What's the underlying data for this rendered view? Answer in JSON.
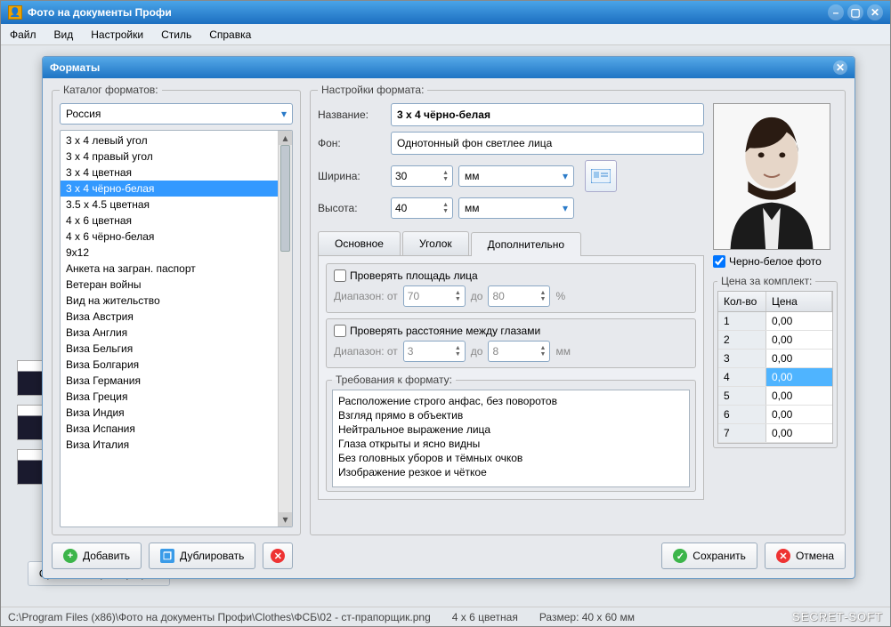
{
  "app": {
    "title": "Фото на документы Профи",
    "menus": [
      "Файл",
      "Вид",
      "Настройки",
      "Стиль",
      "Справка"
    ]
  },
  "dialog": {
    "title": "Форматы",
    "catalog": {
      "legend": "Каталог форматов:",
      "country": "Россия",
      "items": [
        "3 x 4 левый угол",
        "3 x 4 правый угол",
        "3 x 4 цветная",
        "3 x 4 чёрно-белая",
        "3.5 x 4.5 цветная",
        "4 x 6 цветная",
        "4 x 6 чёрно-белая",
        "9x12",
        "Анкета на загран. паспорт",
        "Ветеран войны",
        "Вид на жительство",
        "Виза Австрия",
        "Виза Англия",
        "Виза Бельгия",
        "Виза Болгария",
        "Виза Германия",
        "Виза Греция",
        "Виза Индия",
        "Виза Испания",
        "Виза Италия"
      ],
      "selected_index": 3
    },
    "settings": {
      "legend": "Настройки формата:",
      "name_label": "Название:",
      "name_value": "3 x 4 чёрно-белая",
      "bg_label": "Фон:",
      "bg_value": "Однотонный фон светлее лица",
      "width_label": "Ширина:",
      "width_value": "30",
      "height_label": "Высота:",
      "height_value": "40",
      "unit": "мм",
      "bw_label": "Черно-белое фото",
      "bw_checked": true,
      "tabs": {
        "main": "Основное",
        "corner": "Уголок",
        "extra": "Дополнительно",
        "active": "extra"
      },
      "face_area": {
        "legend": "Проверять площадь лица",
        "checked": false,
        "range_label": "Диапазон: от",
        "from": "70",
        "to_label": "до",
        "to": "80",
        "unit": "%"
      },
      "eye_dist": {
        "legend": "Проверять расстояние между глазами",
        "checked": false,
        "range_label": "Диапазон: от",
        "from": "3",
        "to_label": "до",
        "to": "8",
        "unit": "мм"
      },
      "requirements": {
        "legend": "Требования к формату:",
        "items": [
          "Расположение строго анфас, без поворотов",
          "Взгляд прямо в объектив",
          "Нейтральное выражение лица",
          "Глаза открыты и ясно видны",
          "Без головных уборов и тёмных очков",
          "Изображение резкое и чёткое"
        ]
      },
      "price": {
        "legend": "Цена за комплект:",
        "col_qty": "Кол-во",
        "col_price": "Цена",
        "rows": [
          {
            "qty": "1",
            "price": "0,00"
          },
          {
            "qty": "2",
            "price": "0,00"
          },
          {
            "qty": "3",
            "price": "0,00"
          },
          {
            "qty": "4",
            "price": "0,00"
          },
          {
            "qty": "5",
            "price": "0,00"
          },
          {
            "qty": "6",
            "price": "0,00"
          },
          {
            "qty": "7",
            "price": "0,00"
          }
        ],
        "selected_index": 3
      }
    },
    "buttons": {
      "add": "Добавить",
      "dup": "Дублировать",
      "save": "Сохранить",
      "cancel": "Отмена"
    }
  },
  "background": {
    "compare_btn": "Сравнение фотографий"
  },
  "status": {
    "path": "C:\\Program Files (x86)\\Фото на документы Профи\\Clothes\\ФСБ\\02 - ст-прапорщик.png",
    "format": "4 x 6 цветная",
    "size": "Размер: 40 x 60 мм",
    "brand": "SECRET-SOFT"
  }
}
